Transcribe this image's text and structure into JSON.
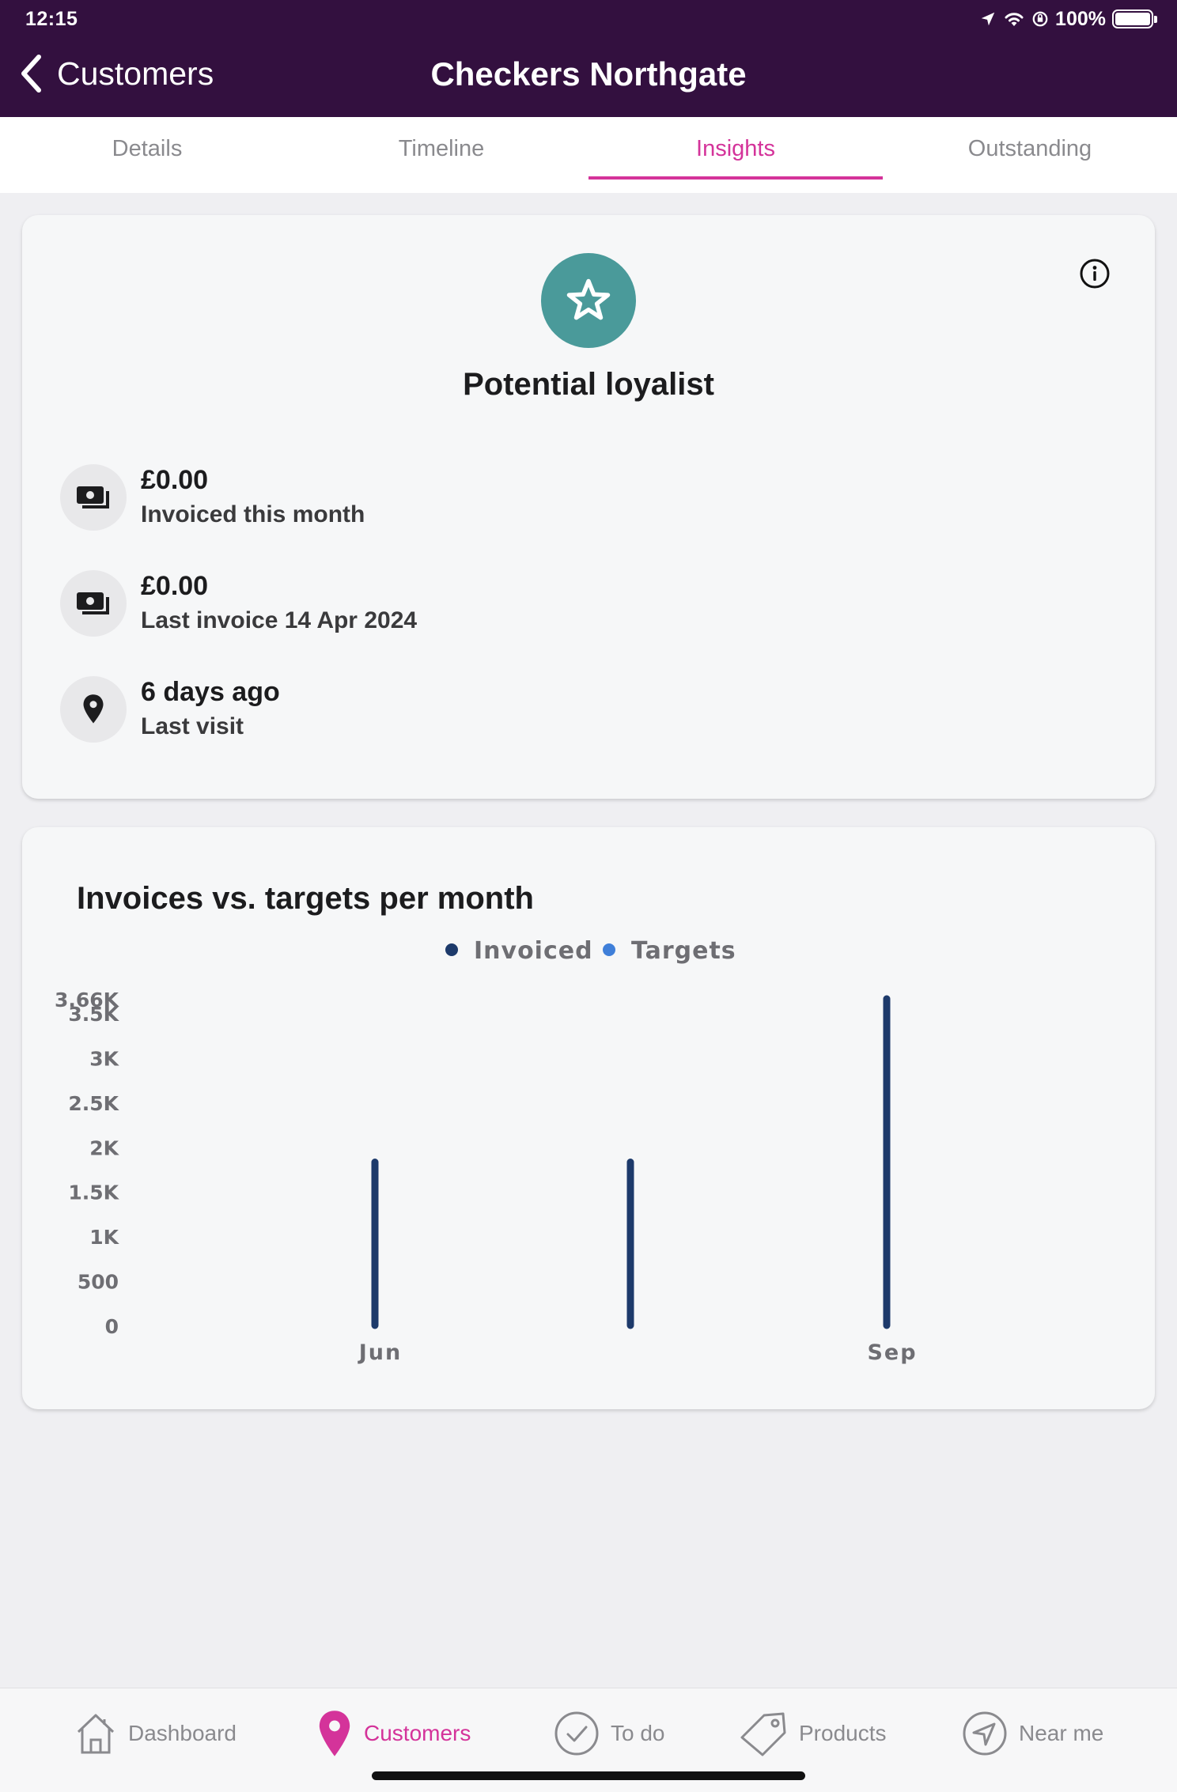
{
  "status_bar": {
    "time": "12:15",
    "battery": "100%"
  },
  "nav": {
    "back_label": "Customers",
    "title": "Checkers Northgate"
  },
  "tabs": [
    {
      "label": "Details",
      "active": false
    },
    {
      "label": "Timeline",
      "active": false
    },
    {
      "label": "Insights",
      "active": true
    },
    {
      "label": "Outstanding",
      "active": false
    }
  ],
  "insights": {
    "segment_icon": "star-icon",
    "segment": "Potential loyalist",
    "stats": [
      {
        "icon": "money-icon",
        "value": "£0.00",
        "label": "Invoiced this month"
      },
      {
        "icon": "money-icon",
        "value": "£0.00",
        "label": "Last invoice 14 Apr 2024"
      },
      {
        "icon": "location-pin-icon",
        "value": "6 days ago",
        "label": "Last visit"
      }
    ]
  },
  "chart_data": {
    "type": "bar",
    "title": "Invoices vs. targets per month",
    "legend": [
      "Invoiced",
      "Targets"
    ],
    "legend_position": "top-center",
    "categories": [
      "Jun",
      "",
      "Sep"
    ],
    "series": [
      {
        "name": "Invoiced",
        "color": "#1d3a6b",
        "values": [
          1830,
          1830,
          3660
        ]
      },
      {
        "name": "Targets",
        "color": "#3f7fd9",
        "values": [
          0,
          0,
          0
        ]
      }
    ],
    "y_ticks": [
      "0",
      "500",
      "1K",
      "1.5K",
      "2K",
      "2.5K",
      "3K",
      "3.5K",
      "3.66K"
    ],
    "y_tick_values": [
      0,
      500,
      1000,
      1500,
      2000,
      2500,
      3000,
      3500,
      3660
    ],
    "ylim": [
      0,
      3660
    ],
    "grid": false
  },
  "bottom_nav": [
    {
      "label": "Dashboard",
      "icon": "home-icon",
      "active": false
    },
    {
      "label": "Customers",
      "icon": "location-pin-icon",
      "active": true
    },
    {
      "label": "To do",
      "icon": "check-circle-icon",
      "active": false
    },
    {
      "label": "Products",
      "icon": "tag-icon",
      "active": false
    },
    {
      "label": "Near me",
      "icon": "navigation-icon",
      "active": false
    }
  ],
  "colors": {
    "header": "#33103f",
    "accent": "#d4339a",
    "badge": "#4a9a9a",
    "invoiced": "#1d3a6b",
    "targets": "#3f7fd9"
  }
}
